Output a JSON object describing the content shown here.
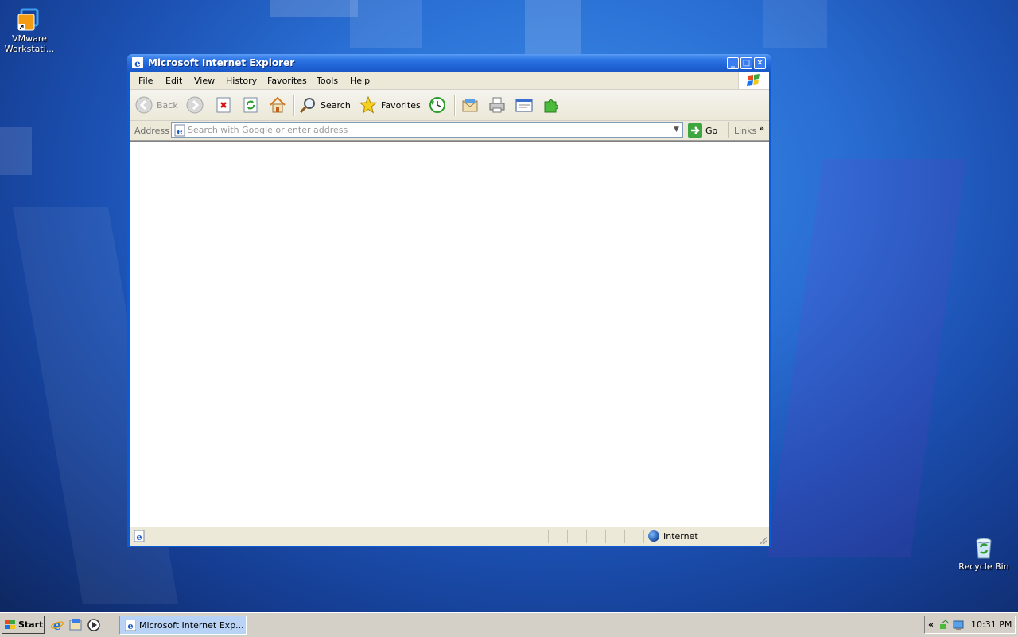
{
  "desktop": {
    "icons": [
      {
        "name": "vmware-workstation",
        "label": "VMware Workstati..."
      },
      {
        "name": "recycle-bin",
        "label": "Recycle Bin"
      }
    ]
  },
  "window": {
    "title": "Microsoft Internet Explorer",
    "menu": [
      "File",
      "Edit",
      "View",
      "History",
      "Favorites",
      "Tools",
      "Help"
    ],
    "toolbar": {
      "back": "Back",
      "search": "Search",
      "favorites": "Favorites"
    },
    "address": {
      "label": "Address",
      "placeholder": "Search with Google or enter address",
      "value": "",
      "go": "Go",
      "links": "Links"
    },
    "status": {
      "zone": "Internet"
    }
  },
  "taskbar": {
    "start": "Start",
    "task_label": "Microsoft Internet Exp...",
    "clock": "10:31 PM"
  },
  "colors": {
    "titlebar": "#1f63d6",
    "chrome": "#ece9d8",
    "taskbar": "#d4d0c8"
  }
}
